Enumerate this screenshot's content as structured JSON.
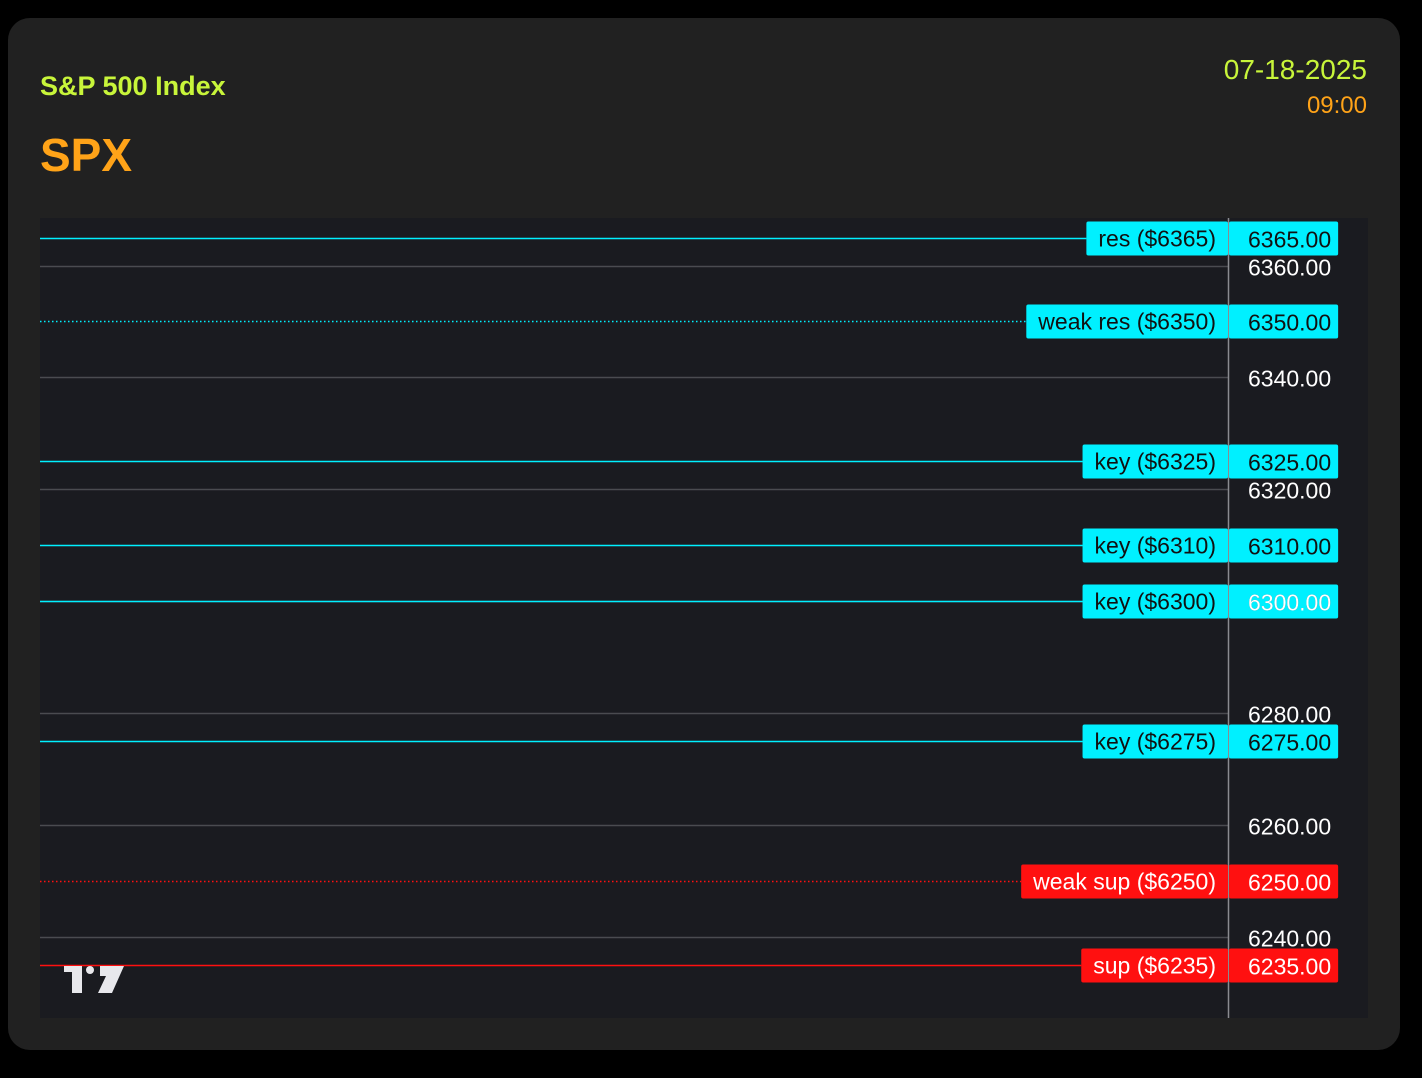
{
  "header": {
    "name": "S&P 500 Index",
    "symbol": "SPX",
    "date": "07-18-2025",
    "time": "09:00"
  },
  "colors": {
    "background": "#000000",
    "card": "#212121",
    "plot_bg": "#1a1b20",
    "name": "#c8f53a",
    "symbol": "#ffa318",
    "resistance": "#00f0ff",
    "support": "#ff1010",
    "grid": "#4a4b50",
    "axis_text": "#ffffff"
  },
  "chart_data": {
    "type": "line",
    "title": "",
    "xlabel": "",
    "ylabel": "",
    "ylim": [
      6225.5,
      6368.5
    ],
    "y_tick_labels": [
      "6360.00",
      "6340.00",
      "6320.00",
      "6300.00",
      "6280.00",
      "6260.00",
      "6240.00"
    ],
    "y_ticks": [
      6360,
      6340,
      6320,
      6300,
      6280,
      6260,
      6240
    ],
    "grid": true,
    "levels": [
      {
        "label": "res ($6365)",
        "value": 6365,
        "price_label": "6365.00",
        "kind": "resistance",
        "style": "solid"
      },
      {
        "label": "weak res ($6350)",
        "value": 6350,
        "price_label": "6350.00",
        "kind": "resistance",
        "style": "dotted"
      },
      {
        "label": "key ($6325)",
        "value": 6325,
        "price_label": "6325.00",
        "kind": "resistance",
        "style": "solid"
      },
      {
        "label": "key ($6310)",
        "value": 6310,
        "price_label": "6310.00",
        "kind": "resistance",
        "style": "solid"
      },
      {
        "label": "key ($6300)",
        "value": 6300,
        "price_label": "6300.00",
        "kind": "resistance",
        "style": "solid"
      },
      {
        "label": "key ($6275)",
        "value": 6275,
        "price_label": "6275.00",
        "kind": "resistance",
        "style": "solid"
      },
      {
        "label": "weak sup ($6250)",
        "value": 6250,
        "price_label": "6250.00",
        "kind": "support",
        "style": "dotted"
      },
      {
        "label": "sup ($6235)",
        "value": 6235,
        "price_label": "6235.00",
        "kind": "support",
        "style": "solid"
      }
    ],
    "logo": "tradingview-logo"
  }
}
